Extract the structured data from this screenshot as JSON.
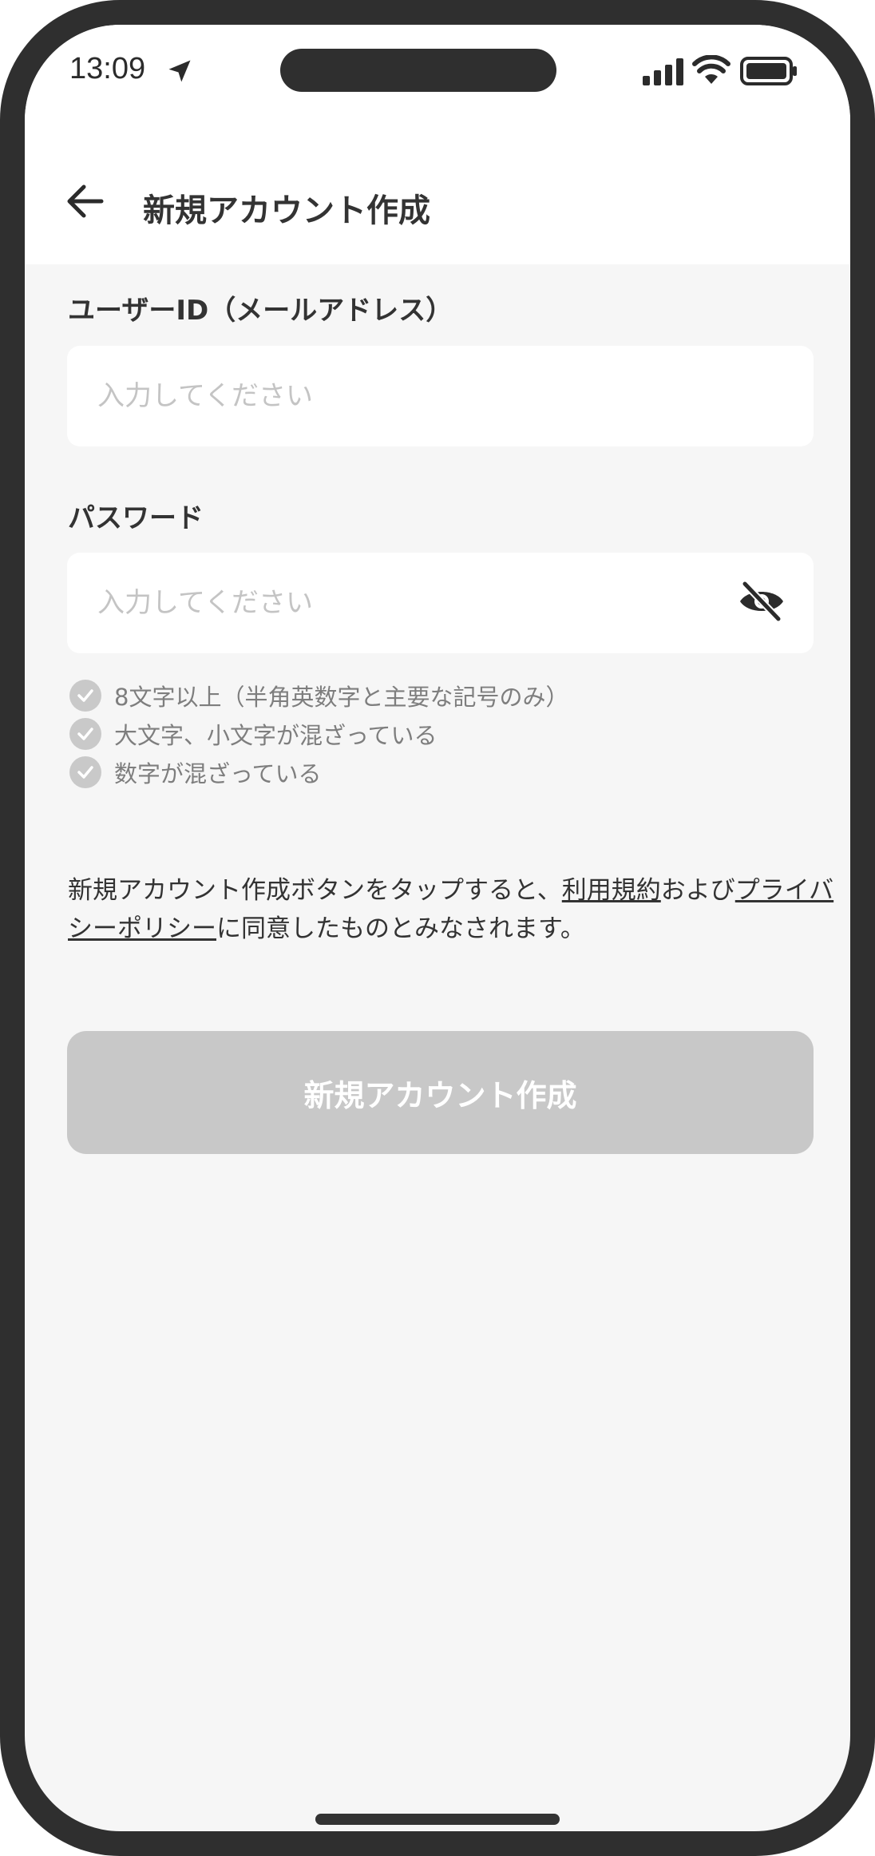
{
  "status_bar": {
    "time": "13:09",
    "icons": [
      "location-arrow-icon",
      "signal-icon",
      "wifi-icon",
      "battery-icon"
    ]
  },
  "header": {
    "back_icon": "arrow-left-icon",
    "title": "新規アカウント作成"
  },
  "form": {
    "user_id": {
      "label": "ユーザーID（メールアドレス）",
      "value": "",
      "placeholder": "入力してください"
    },
    "password": {
      "label": "パスワード",
      "value": "",
      "placeholder": "入力してください",
      "visibility_icon": "eye-slash-icon"
    },
    "rules": [
      {
        "text": "8文字以上（半角英数字と主要な記号のみ）",
        "icon": "check-circle-icon"
      },
      {
        "text": "大文字、小文字が混ざっている",
        "icon": "check-circle-icon"
      },
      {
        "text": "数字が混ざっている",
        "icon": "check-circle-icon"
      }
    ]
  },
  "consent": {
    "prefix": "新規アカウント作成ボタンをタップすると、",
    "terms_link": "利用規約",
    "middle": "および",
    "privacy_link": "プライバシーポリシー",
    "suffix": "に同意したものとみなされます。"
  },
  "submit": {
    "label": "新規アカウント作成",
    "state": "disabled"
  },
  "colors": {
    "text_primary": "#333333",
    "placeholder": "#c4c4c4",
    "rule_text": "#7e7e7e",
    "rule_check": "#c9c9c9",
    "button_disabled": "#c8c8c8",
    "background": "#f6f6f6"
  }
}
